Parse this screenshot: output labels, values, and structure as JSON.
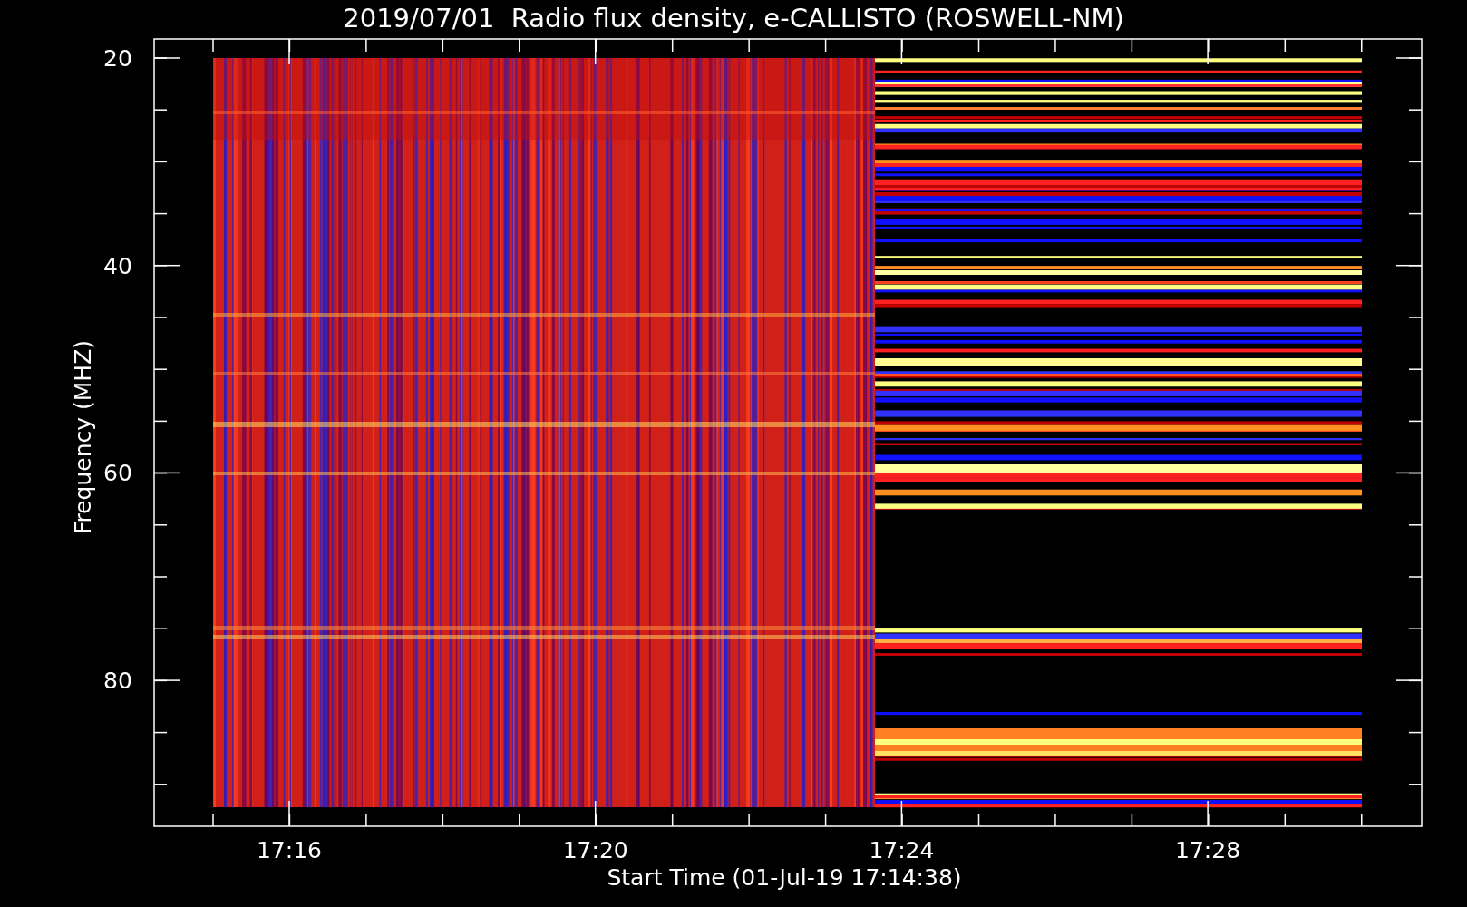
{
  "title": "2019/07/01  Radio flux density, e-CALLISTO (ROSWELL-NM)",
  "plot": {
    "ylabel": "Frequency (MHZ)",
    "xlabel": "Start Time (01-Jul-19 17:14:38)",
    "yticks": [
      "20",
      "40",
      "60",
      "80"
    ],
    "xticks": [
      "17:16",
      "17:20",
      "17:24",
      "17:28"
    ]
  }
}
